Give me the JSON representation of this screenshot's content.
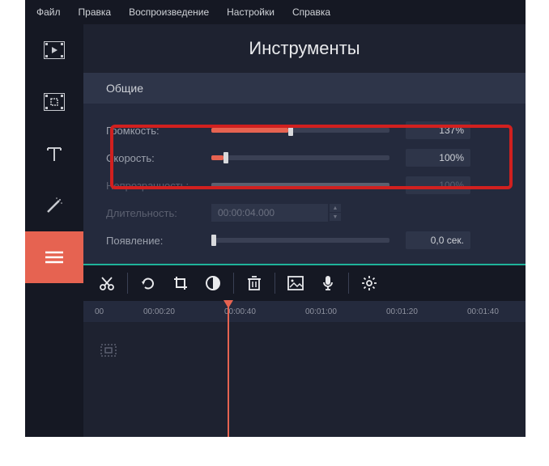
{
  "menu": {
    "file": "Файл",
    "edit": "Правка",
    "playback": "Воспроизведение",
    "settings": "Настройки",
    "help": "Справка"
  },
  "title": "Инструменты",
  "panel": {
    "header": "Общие",
    "volume": {
      "label": "Громкость:",
      "value": "137%",
      "fill": 43
    },
    "speed": {
      "label": "Скорость:",
      "value": "100%",
      "fill": 7
    },
    "opacity": {
      "label": "Непрозрачность:",
      "value": "100%",
      "fill": 100
    },
    "duration": {
      "label": "Длительность:",
      "value": "00:00:04.000"
    },
    "appearance": {
      "label": "Появление:",
      "value": "0,0 сек.",
      "fill": 0
    }
  },
  "ruler": {
    "t0": "00",
    "t1": "00:00:20",
    "t2": "00:00:40",
    "t3": "00:01:00",
    "t4": "00:01:20",
    "t5": "00:01:40"
  }
}
